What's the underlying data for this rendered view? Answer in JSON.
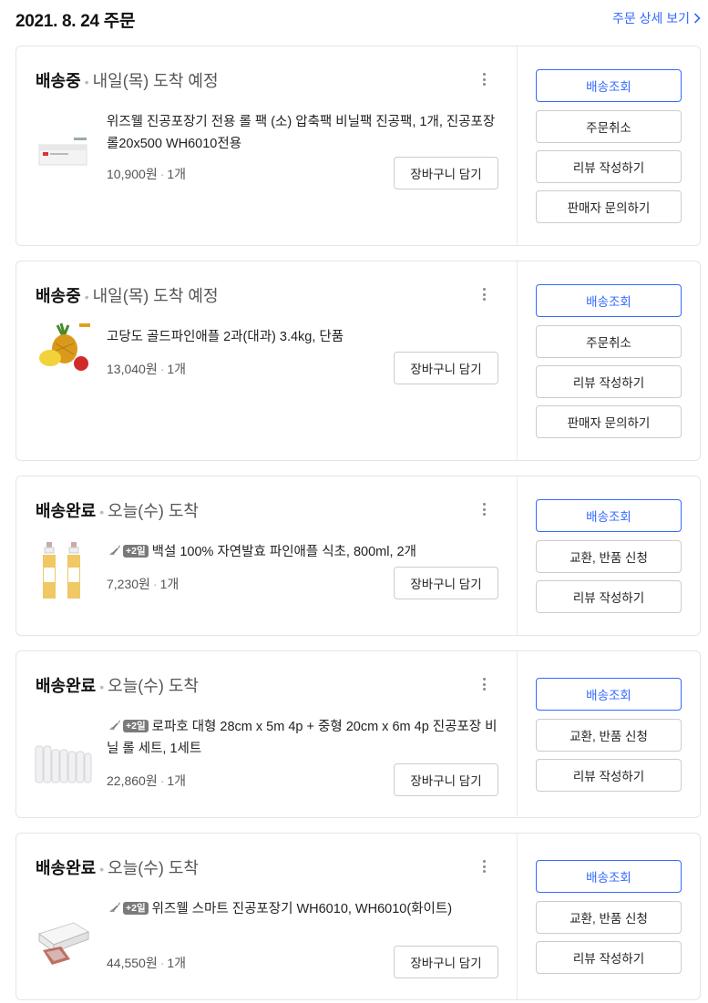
{
  "header": {
    "order_date": "2021. 8. 24 주문",
    "detail_link": "주문 상세 보기"
  },
  "orders": [
    {
      "status": "배송중",
      "status_sub": "내일(목) 도착 예정",
      "title": "위즈웰 진공포장기 전용 롤 팩 (소) 압축팩 비닐팩 진공팩, 1개, 진공포장롤20x500 WH6010전용",
      "price": "10,900원",
      "qty": "1개",
      "cart_label": "장바구니 담기",
      "image": "vacuum-roll-box",
      "badge": "",
      "actions": [
        "배송조회",
        "주문취소",
        "리뷰 작성하기",
        "판매자 문의하기"
      ]
    },
    {
      "status": "배송중",
      "status_sub": "내일(목) 도착 예정",
      "title": "고당도 골드파인애플 2과(대과) 3.4kg, 단품",
      "price": "13,040원",
      "qty": "1개",
      "cart_label": "장바구니 담기",
      "image": "pineapple",
      "badge": "",
      "actions": [
        "배송조회",
        "주문취소",
        "리뷰 작성하기",
        "판매자 문의하기"
      ]
    },
    {
      "status": "배송완료",
      "status_sub": "오늘(수) 도착",
      "title": "백설 100% 자연발효 파인애플 식초, 800ml, 2개",
      "price": "7,230원",
      "qty": "1개",
      "cart_label": "장바구니 담기",
      "image": "vinegar-bottles",
      "badge": "+2일",
      "actions": [
        "배송조회",
        "교환, 반품 신청",
        "리뷰 작성하기"
      ]
    },
    {
      "status": "배송완료",
      "status_sub": "오늘(수) 도착",
      "title": "로파호 대형 28cm x 5m 4p + 중형 20cm x 6m 4p 진공포장 비닐 롤 세트, 1세트",
      "price": "22,860원",
      "qty": "1개",
      "cart_label": "장바구니 담기",
      "image": "vacuum-rolls",
      "badge": "+2일",
      "actions": [
        "배송조회",
        "교환, 반품 신청",
        "리뷰 작성하기"
      ]
    },
    {
      "status": "배송완료",
      "status_sub": "오늘(수) 도착",
      "title": "위즈웰 스마트 진공포장기 WH6010, WH6010(화이트)",
      "price": "44,550원",
      "qty": "1개",
      "cart_label": "장바구니 담기",
      "image": "vacuum-sealer",
      "badge": "+2일",
      "actions": [
        "배송조회",
        "교환, 반품 신청",
        "리뷰 작성하기"
      ]
    }
  ],
  "colors": {
    "accent": "#346aff",
    "border": "#e5e5e5",
    "badge": "#7a7a7a"
  }
}
